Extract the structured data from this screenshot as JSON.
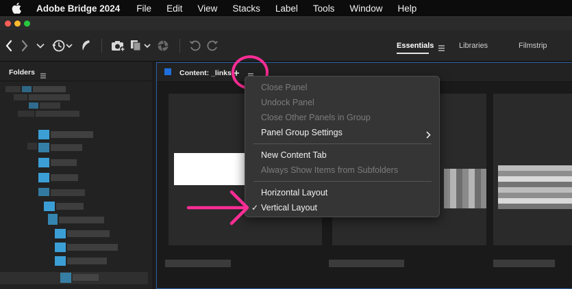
{
  "menubar": {
    "app_name": "Adobe Bridge 2024",
    "items": [
      "File",
      "Edit",
      "View",
      "Stacks",
      "Label",
      "Tools",
      "Window",
      "Help"
    ]
  },
  "toolbar": {
    "workspaces": [
      {
        "label": "Essentials",
        "active": true
      },
      {
        "label": "Libraries",
        "active": false
      },
      {
        "label": "Filmstrip",
        "active": false
      }
    ],
    "icons": [
      "back-arrow-icon",
      "forward-arrow-icon",
      "chevron-down-icon",
      "recent-history-icon",
      "boomerang-icon",
      "camera-get-photos-icon",
      "refine-copy-icon",
      "open-in-camera-raw-icon",
      "rotate-left-icon",
      "rotate-right-icon"
    ]
  },
  "folders_panel": {
    "title": "Folders"
  },
  "content_panel": {
    "title": "Content: _links"
  },
  "context_menu": {
    "items": [
      {
        "label": "Close Panel",
        "enabled": false
      },
      {
        "label": "Undock Panel",
        "enabled": false
      },
      {
        "label": "Close Other Panels in Group",
        "enabled": false
      },
      {
        "label": "Panel Group Settings",
        "enabled": true,
        "submenu": true
      },
      {
        "label": "New Content Tab",
        "enabled": true
      },
      {
        "label": "Always Show Items from Subfolders",
        "enabled": false
      },
      {
        "label": "Horizontal Layout",
        "enabled": true
      },
      {
        "label": "Vertical Layout",
        "enabled": true,
        "checked": true
      }
    ]
  },
  "colors": {
    "annotation": "#ff2d96",
    "accent_blue": "#1f6fdc",
    "folder_blue": "#3b9fd6"
  }
}
